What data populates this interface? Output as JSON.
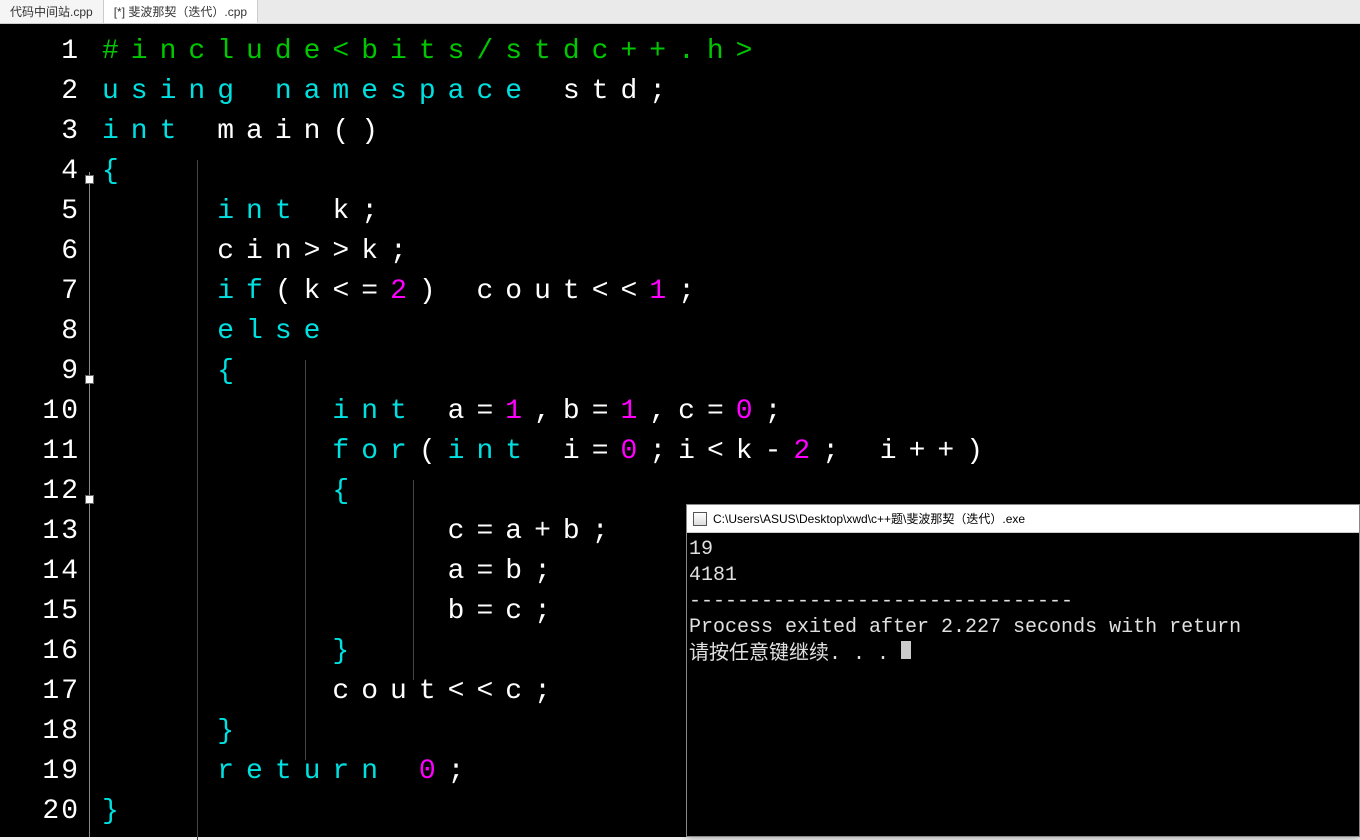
{
  "tabs": [
    {
      "label": "代码中间站.cpp",
      "active": false
    },
    {
      "label": "[*] 斐波那契（迭代）.cpp",
      "active": true
    }
  ],
  "code_lines": [
    [
      {
        "c": "tk-pre",
        "t": "#include<bits/stdc++.h>"
      }
    ],
    [
      {
        "c": "tk-kw",
        "t": "using"
      },
      {
        "c": "tk-id",
        "t": " "
      },
      {
        "c": "tk-kw",
        "t": "namespace"
      },
      {
        "c": "tk-id",
        "t": " std"
      },
      {
        "c": "tk-punc",
        "t": ";"
      }
    ],
    [
      {
        "c": "tk-kw",
        "t": "int"
      },
      {
        "c": "tk-id",
        "t": " main"
      },
      {
        "c": "tk-paren",
        "t": "()"
      }
    ],
    [
      {
        "c": "tk-brace",
        "t": "{"
      }
    ],
    [
      {
        "c": "tk-id",
        "t": "    "
      },
      {
        "c": "tk-kw",
        "t": "int"
      },
      {
        "c": "tk-id",
        "t": " k"
      },
      {
        "c": "tk-punc",
        "t": ";"
      }
    ],
    [
      {
        "c": "tk-id",
        "t": "    cin"
      },
      {
        "c": "tk-op",
        "t": ">>"
      },
      {
        "c": "tk-id",
        "t": "k"
      },
      {
        "c": "tk-punc",
        "t": ";"
      }
    ],
    [
      {
        "c": "tk-id",
        "t": "    "
      },
      {
        "c": "tk-kw",
        "t": "if"
      },
      {
        "c": "tk-paren",
        "t": "("
      },
      {
        "c": "tk-id",
        "t": "k"
      },
      {
        "c": "tk-op",
        "t": "<="
      },
      {
        "c": "tk-num",
        "t": "2"
      },
      {
        "c": "tk-paren",
        "t": ")"
      },
      {
        "c": "tk-id",
        "t": " cout"
      },
      {
        "c": "tk-op",
        "t": "<<"
      },
      {
        "c": "tk-num",
        "t": "1"
      },
      {
        "c": "tk-punc",
        "t": ";"
      }
    ],
    [
      {
        "c": "tk-id",
        "t": "    "
      },
      {
        "c": "tk-kw",
        "t": "else"
      }
    ],
    [
      {
        "c": "tk-id",
        "t": "    "
      },
      {
        "c": "tk-brace",
        "t": "{"
      }
    ],
    [
      {
        "c": "tk-id",
        "t": "        "
      },
      {
        "c": "tk-kw",
        "t": "int"
      },
      {
        "c": "tk-id",
        "t": " a"
      },
      {
        "c": "tk-op",
        "t": "="
      },
      {
        "c": "tk-num",
        "t": "1"
      },
      {
        "c": "tk-punc",
        "t": ","
      },
      {
        "c": "tk-id",
        "t": "b"
      },
      {
        "c": "tk-op",
        "t": "="
      },
      {
        "c": "tk-num",
        "t": "1"
      },
      {
        "c": "tk-punc",
        "t": ","
      },
      {
        "c": "tk-id",
        "t": "c"
      },
      {
        "c": "tk-op",
        "t": "="
      },
      {
        "c": "tk-num",
        "t": "0"
      },
      {
        "c": "tk-punc",
        "t": ";"
      }
    ],
    [
      {
        "c": "tk-id",
        "t": "        "
      },
      {
        "c": "tk-kw",
        "t": "for"
      },
      {
        "c": "tk-paren",
        "t": "("
      },
      {
        "c": "tk-kw",
        "t": "int"
      },
      {
        "c": "tk-id",
        "t": " i"
      },
      {
        "c": "tk-op",
        "t": "="
      },
      {
        "c": "tk-num",
        "t": "0"
      },
      {
        "c": "tk-punc",
        "t": ";"
      },
      {
        "c": "tk-id",
        "t": "i"
      },
      {
        "c": "tk-op",
        "t": "<"
      },
      {
        "c": "tk-id",
        "t": "k"
      },
      {
        "c": "tk-op",
        "t": "-"
      },
      {
        "c": "tk-num",
        "t": "2"
      },
      {
        "c": "tk-punc",
        "t": ";"
      },
      {
        "c": "tk-id",
        "t": " i"
      },
      {
        "c": "tk-op",
        "t": "++"
      },
      {
        "c": "tk-paren",
        "t": ")"
      }
    ],
    [
      {
        "c": "tk-id",
        "t": "        "
      },
      {
        "c": "tk-brace",
        "t": "{"
      }
    ],
    [
      {
        "c": "tk-id",
        "t": "            c"
      },
      {
        "c": "tk-op",
        "t": "="
      },
      {
        "c": "tk-id",
        "t": "a"
      },
      {
        "c": "tk-op",
        "t": "+"
      },
      {
        "c": "tk-id",
        "t": "b"
      },
      {
        "c": "tk-punc",
        "t": ";"
      }
    ],
    [
      {
        "c": "tk-id",
        "t": "            a"
      },
      {
        "c": "tk-op",
        "t": "="
      },
      {
        "c": "tk-id",
        "t": "b"
      },
      {
        "c": "tk-punc",
        "t": ";"
      }
    ],
    [
      {
        "c": "tk-id",
        "t": "            b"
      },
      {
        "c": "tk-op",
        "t": "="
      },
      {
        "c": "tk-id",
        "t": "c"
      },
      {
        "c": "tk-punc",
        "t": ";"
      }
    ],
    [
      {
        "c": "tk-id",
        "t": "        "
      },
      {
        "c": "tk-brace",
        "t": "}"
      }
    ],
    [
      {
        "c": "tk-id",
        "t": "        cout"
      },
      {
        "c": "tk-op",
        "t": "<<"
      },
      {
        "c": "tk-id",
        "t": "c"
      },
      {
        "c": "tk-punc",
        "t": ";"
      }
    ],
    [
      {
        "c": "tk-id",
        "t": "    "
      },
      {
        "c": "tk-brace",
        "t": "}"
      }
    ],
    [
      {
        "c": "tk-id",
        "t": "    "
      },
      {
        "c": "tk-kw",
        "t": "return"
      },
      {
        "c": "tk-id",
        "t": " "
      },
      {
        "c": "tk-num",
        "t": "0"
      },
      {
        "c": "tk-punc",
        "t": ";"
      }
    ],
    [
      {
        "c": "tk-brace",
        "t": "}"
      }
    ]
  ],
  "fold_markers_at_lines": [
    4,
    9,
    12
  ],
  "console": {
    "title": "C:\\Users\\ASUS\\Desktop\\xwd\\c++题\\斐波那契（迭代）.exe",
    "lines": [
      "19",
      "4181",
      "--------------------------------",
      "Process exited after 2.227 seconds with return",
      "请按任意键继续. . . "
    ]
  }
}
